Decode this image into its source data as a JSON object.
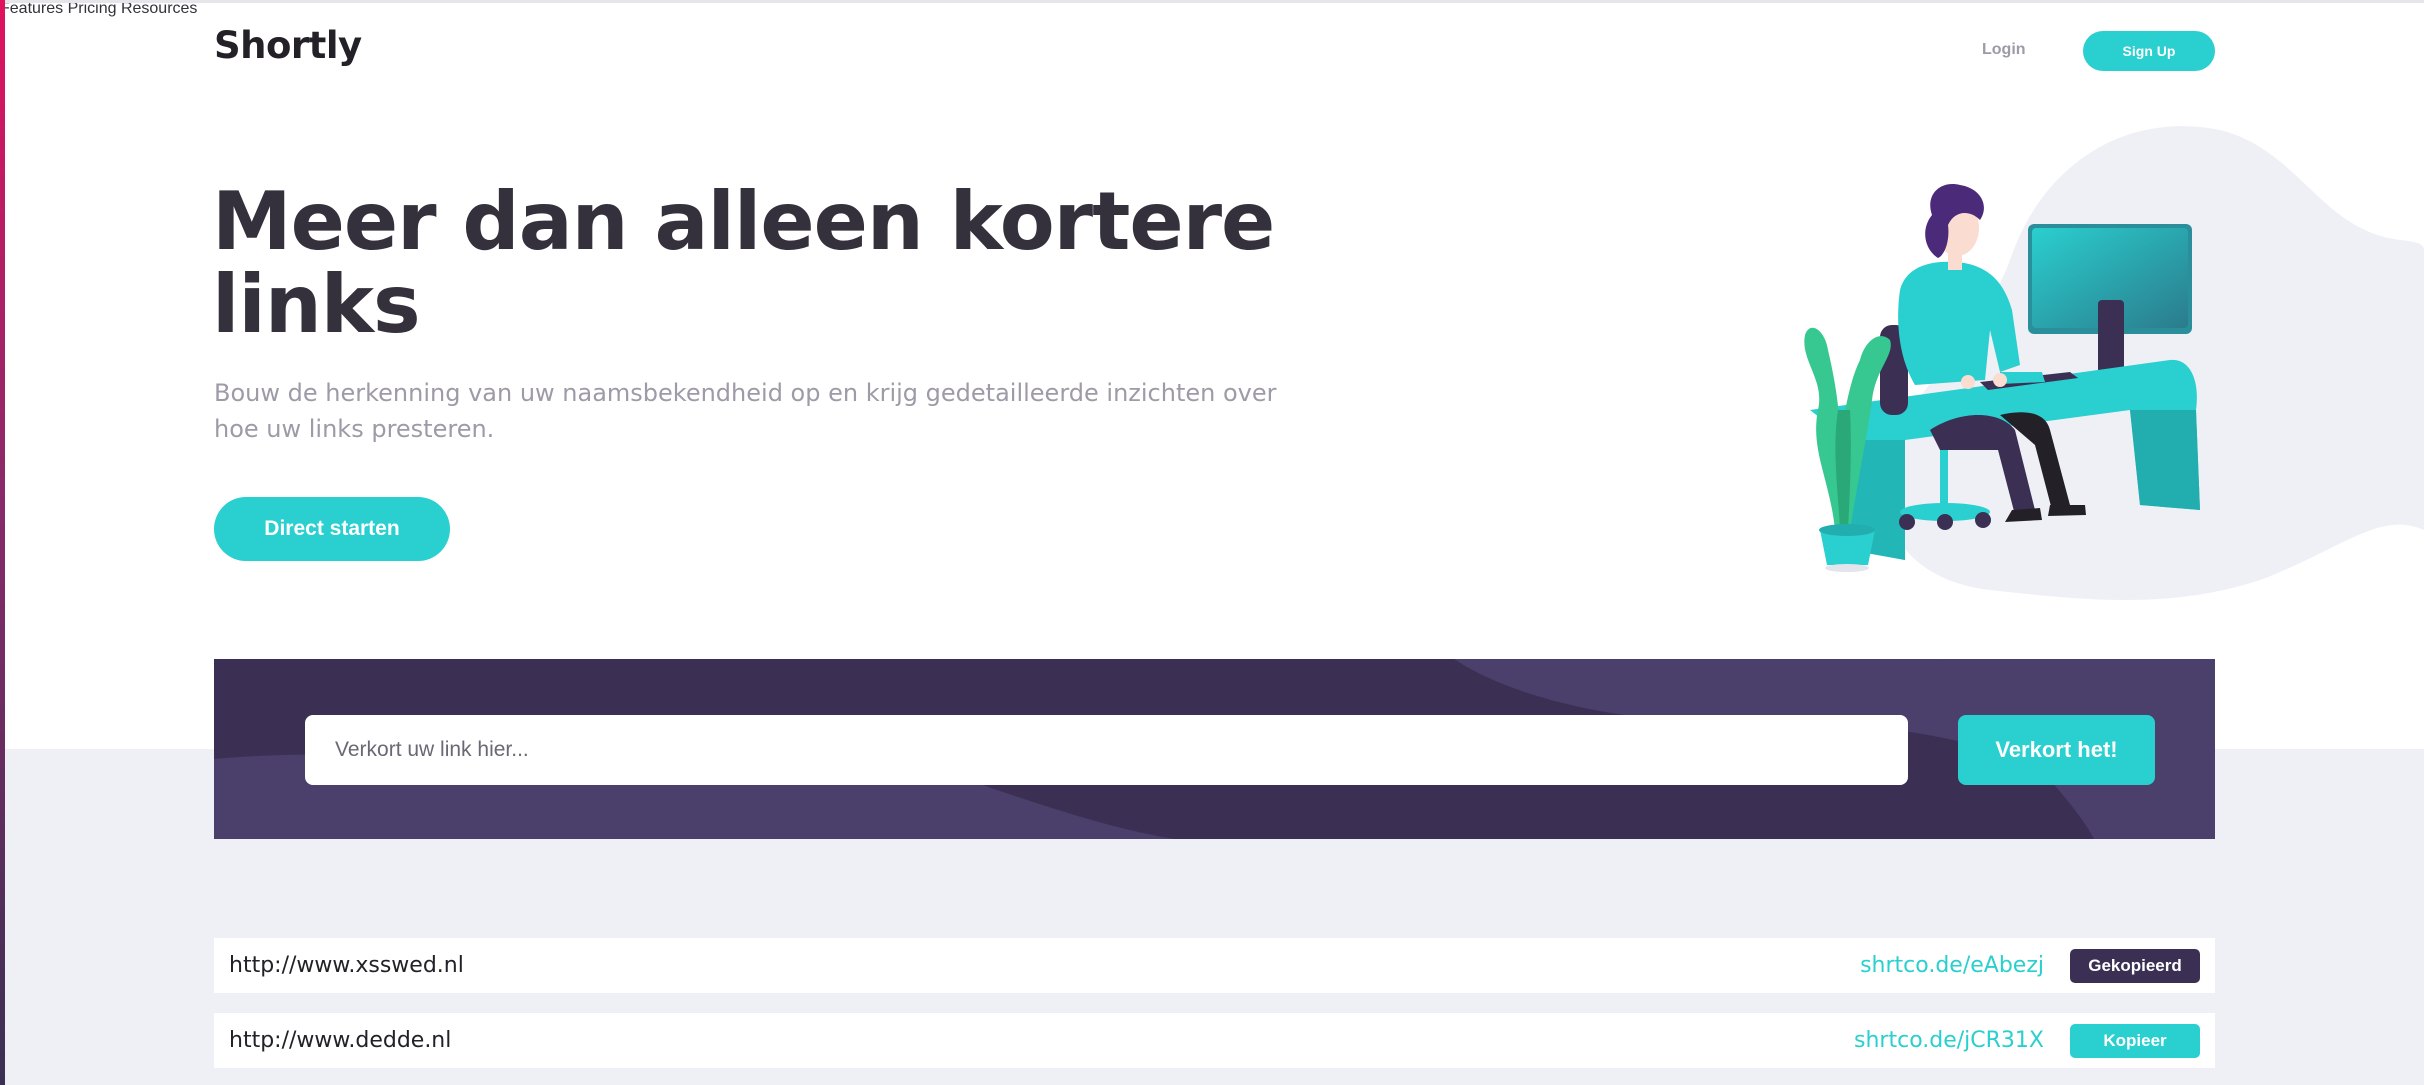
{
  "brand": {
    "logo": "Shortly",
    "accent": "#2acfcf",
    "dark_violet": "#3b3054"
  },
  "nav": {
    "items": [
      "Features",
      "Pricing",
      "Resources"
    ],
    "login": "Login",
    "signup": "Sign Up"
  },
  "hero": {
    "title": "Meer dan alleen kortere links",
    "subtitle": "Bouw de herkenning van uw naamsbekendheid op en krijg gedetailleerde inzichten over hoe uw links presteren.",
    "cta": "Direct starten"
  },
  "shortener": {
    "placeholder": "Verkort uw link hier...",
    "button": "Verkort het!"
  },
  "results": [
    {
      "original": "http://www.xsswed.nl",
      "short": "shrtco.de/eAbezj",
      "button": "Gekopieerd",
      "copied": true
    },
    {
      "original": "http://www.dedde.nl",
      "short": "shrtco.de/jCR31X",
      "button": "Kopieer",
      "copied": false
    }
  ]
}
